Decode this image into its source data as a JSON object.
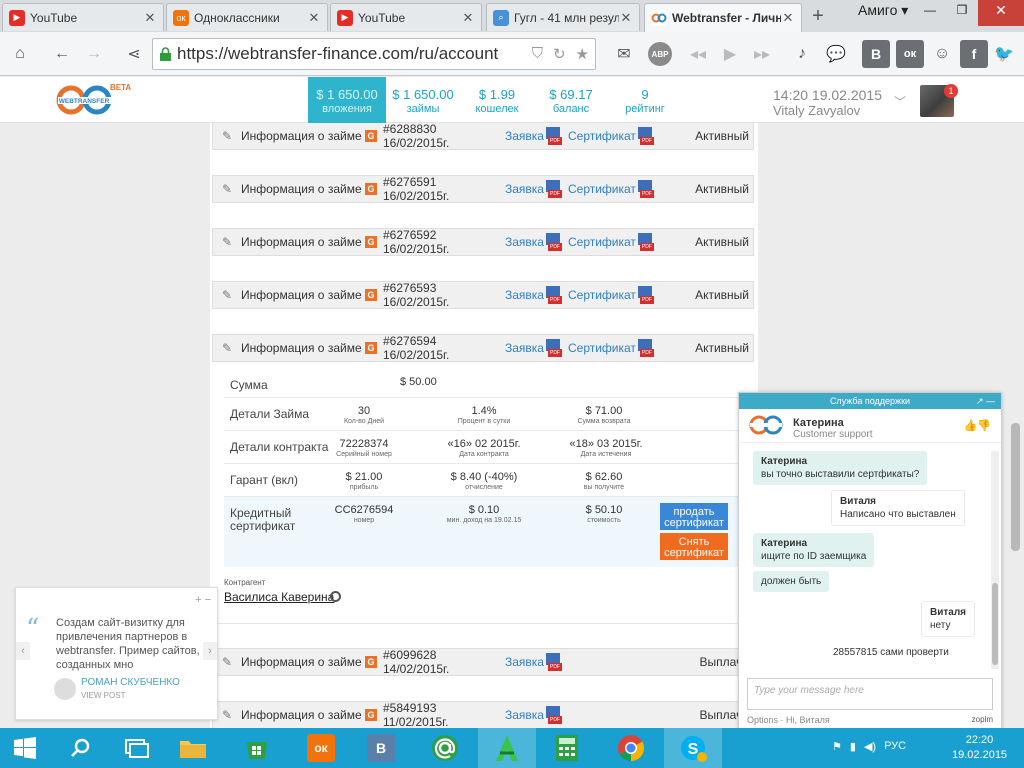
{
  "browser": {
    "tabs": [
      {
        "title": "YouTube",
        "icon": "youtube-icon",
        "color": "#e52d27"
      },
      {
        "title": "Одноклассники",
        "icon": "odnoklassniki-icon",
        "color": "#f2720c"
      },
      {
        "title": "YouTube",
        "icon": "youtube-icon",
        "color": "#e52d27"
      },
      {
        "title": "Гугл - 41 млн резул",
        "icon": "search-icon",
        "color": "#4a90d9"
      },
      {
        "title": "Webtransfer - Личн",
        "icon": "webtransfer-icon",
        "color": "#2b86c5"
      }
    ],
    "new_tab": "+",
    "profile": "Амиго ▾",
    "url": "https://webtransfer-finance.com/ru/account",
    "toolbar_letters": {
      "abp": "ABP",
      "vk": "В",
      "ok": "ок",
      "fb": "f"
    }
  },
  "site": {
    "logo_text": "WEBTRANSFER",
    "beta": "BETA",
    "stats": [
      {
        "value": "$ 1 650.00",
        "label": "вложения"
      },
      {
        "value": "$ 1 650.00",
        "label": "займы"
      },
      {
        "value": "$ 1.99",
        "label": "кошелек"
      },
      {
        "value": "$ 69.17",
        "label": "баланс"
      },
      {
        "value": "9",
        "label": "рейтинг"
      }
    ],
    "datetime": "14:20 19.02.2015",
    "username": "Vitaly Zavyalov",
    "notifications": "1"
  },
  "loans": [
    {
      "label": "Информация о займе",
      "g": "G",
      "number": "#6288830 16/02/2015г.",
      "request": "Заявка",
      "certificate": "Сертификат",
      "status": "Активный"
    },
    {
      "label": "Информация о займе",
      "g": "G",
      "number": "#6276591 16/02/2015г.",
      "request": "Заявка",
      "certificate": "Сертификат",
      "status": "Активный"
    },
    {
      "label": "Информация о займе",
      "g": "G",
      "number": "#6276592 16/02/2015г.",
      "request": "Заявка",
      "certificate": "Сертификат",
      "status": "Активный"
    },
    {
      "label": "Информация о займе",
      "g": "G",
      "number": "#6276593 16/02/2015г.",
      "request": "Заявка",
      "certificate": "Сертификат",
      "status": "Активный"
    },
    {
      "label": "Информация о займе",
      "g": "G",
      "number": "#6276594 16/02/2015г.",
      "request": "Заявка",
      "certificate": "Сертификат",
      "status": "Активный"
    },
    {
      "label": "Информация о займе",
      "g": "G",
      "number": "#6099628 14/02/2015г.",
      "request": "Заявка",
      "certificate": "",
      "status": "Выплаче"
    },
    {
      "label": "Информация о займе",
      "g": "G",
      "number": "#5849193 11/02/2015г.",
      "request": "Заявка",
      "certificate": "",
      "status": "Выплаче"
    }
  ],
  "details": {
    "sum_label": "Сумма",
    "sum_value": "$ 50.00",
    "loan_details_label": "Детали Займа",
    "days": {
      "value": "30",
      "caption": "Кол-во Дней"
    },
    "rate": {
      "value": "1.4%",
      "caption": "Процент в сутки"
    },
    "refund": {
      "value": "$ 71.00",
      "caption": "Сумма возврата"
    },
    "contract_label": "Детали контракта",
    "serial": {
      "value": "72228374",
      "caption": "Серийный номер"
    },
    "contract_date": {
      "value": "«16» 02 2015г.",
      "caption": "Дата контракта"
    },
    "expiry": {
      "value": "«18» 03 2015г.",
      "caption": "Дата истечения"
    },
    "guarantee_label": "Гарант (вкл)",
    "profit": {
      "value": "$ 21.00",
      "caption": "прибыль"
    },
    "deduction": {
      "value": "$ 8.40 (-40%)",
      "caption": "отчисление"
    },
    "receive": {
      "value": "$ 62.60",
      "caption": "вы получите"
    },
    "credit_label": "Кредитный сертификат",
    "cert_number": {
      "value": "CC6276594",
      "caption": "номер"
    },
    "min_income": {
      "value": "$ 0.10",
      "caption": "мин. доход на 19.02.15"
    },
    "cost": {
      "value": "$ 50.10",
      "caption": "стоимость"
    },
    "sell_button": "продать сертификат",
    "remove_button": "Снять сертификат",
    "counterparty_label": "Контрагент",
    "counterparty_name": "Василиса Каверина"
  },
  "promo": {
    "quote_mark": "“",
    "text": "Создам сайт-визитку для привлечения партнеров в webtransfer. Пример сайтов, созданных мно",
    "author": "РОМАН СКУБЧЕНКО",
    "view_post": "VIEW POST",
    "controls": "+ −"
  },
  "chat": {
    "title": "Служба поддержки",
    "agent_name": "Катерина",
    "agent_role": "Customer support",
    "messages": [
      {
        "author": "Катерина",
        "text": "вы точно выставили сертфикаты?",
        "side": "op"
      },
      {
        "author": "Виталя",
        "text": "Написано что выставлен",
        "side": "me"
      },
      {
        "author": "Катерина",
        "text": "ищите по ID заемщика",
        "side": "op"
      },
      {
        "author": "",
        "text": "должен быть",
        "side": "op"
      },
      {
        "author": "Виталя",
        "text": "нету",
        "side": "me"
      },
      {
        "author": "",
        "text": "28557815 сами проверти",
        "side": "me"
      }
    ],
    "input_placeholder": "Type your message here",
    "options": "Options · Hi, Виталя",
    "brand": "zoplm"
  },
  "taskbar": {
    "clock_time": "22:20",
    "clock_date": "19.02.2015",
    "lang": "РУС"
  }
}
